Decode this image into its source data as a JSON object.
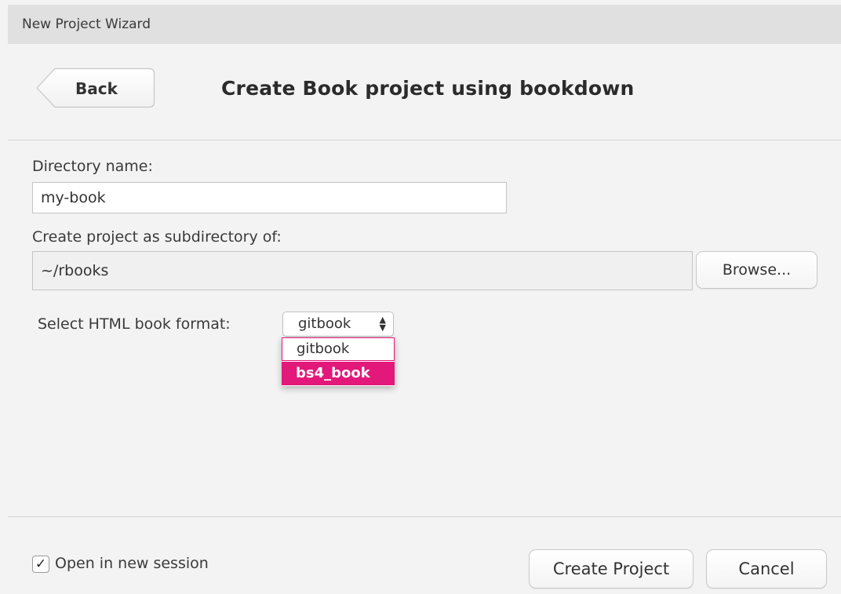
{
  "window": {
    "title": "New Project Wizard"
  },
  "header": {
    "back_label": "Back",
    "title": "Create Book project using bookdown"
  },
  "form": {
    "directory_label": "Directory name:",
    "directory_value": "my-book",
    "parent_label": "Create project as subdirectory of:",
    "parent_value": "~/rbooks",
    "browse_label": "Browse...",
    "format_label": "Select HTML book format:",
    "format_selected": "gitbook",
    "format_options": [
      "gitbook",
      "bs4_book"
    ],
    "format_highlighted": "bs4_book"
  },
  "footer": {
    "open_session_label": "Open in new session",
    "open_session_checked": true,
    "create_label": "Create Project",
    "cancel_label": "Cancel"
  },
  "colors": {
    "highlight": "#e2187a"
  }
}
